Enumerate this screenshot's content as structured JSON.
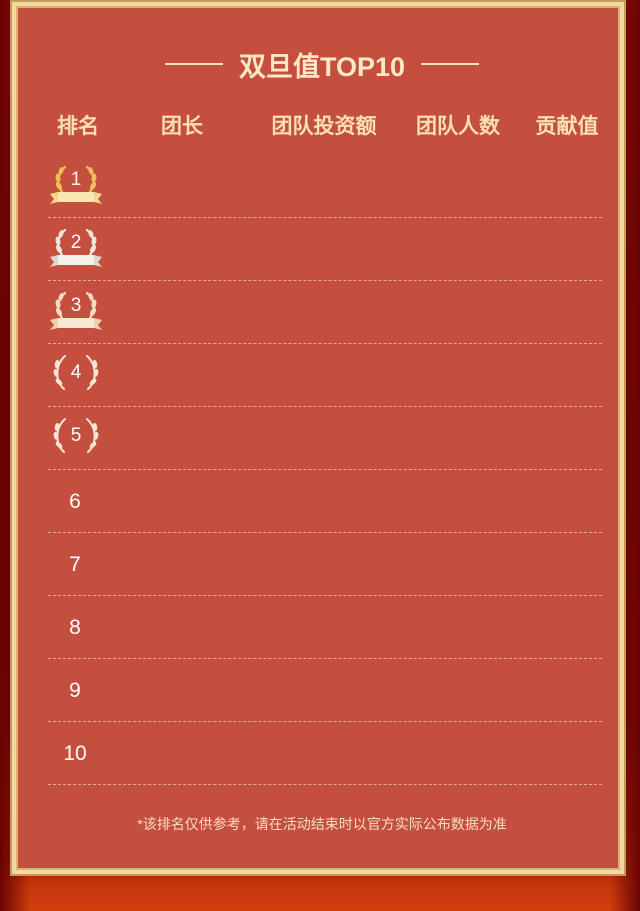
{
  "board": {
    "title": "双旦值TOP10",
    "columns": {
      "rank": "排名",
      "leader": "团长",
      "investment": "团队投资额",
      "members": "团队人数",
      "contribution": "贡献值"
    },
    "rows": [
      {
        "rank": "1",
        "medal": "gold-laurel-ribbon"
      },
      {
        "rank": "2",
        "medal": "silver-laurel-ribbon"
      },
      {
        "rank": "3",
        "medal": "bronze-laurel-ribbon"
      },
      {
        "rank": "4",
        "medal": "laurel"
      },
      {
        "rank": "5",
        "medal": "laurel"
      },
      {
        "rank": "6"
      },
      {
        "rank": "7"
      },
      {
        "rank": "8"
      },
      {
        "rank": "9"
      },
      {
        "rank": "10"
      }
    ],
    "footnote": "*该排名仅供参考，请在活动结束时以官方实际公布数据为准"
  },
  "colors": {
    "panel": "#c54f3e",
    "frame": "#f1d8a2",
    "header_text": "#f9dfb1",
    "gold": "#f3c15a",
    "silver": "#e7e2d8"
  }
}
